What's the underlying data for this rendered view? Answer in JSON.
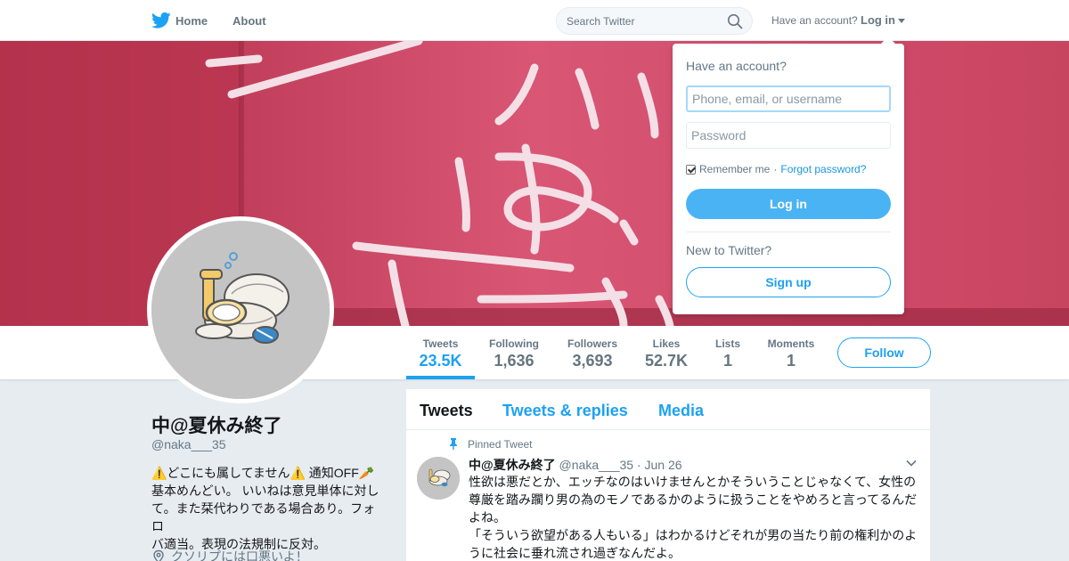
{
  "nav": {
    "home_label": "Home",
    "about_label": "About",
    "search_placeholder": "Search Twitter",
    "have_account": "Have an account?",
    "login_label": "Log in"
  },
  "profile": {
    "name": "中@夏休み終了",
    "handle": "@naka___35",
    "bio_lines": [
      "⚠️どこにも属してません⚠️ 通知OFF🥕",
      "基本めんどい。 いいねは意見単体に対し",
      "て。また栞代わりである場合あり。フォロ",
      "バ適当。表現の法規制に反対。"
    ],
    "location": "クソリプには口悪いよ！"
  },
  "stats": [
    {
      "label": "Tweets",
      "value": "23.5K"
    },
    {
      "label": "Following",
      "value": "1,636"
    },
    {
      "label": "Followers",
      "value": "3,693"
    },
    {
      "label": "Likes",
      "value": "52.7K"
    },
    {
      "label": "Lists",
      "value": "1"
    },
    {
      "label": "Moments",
      "value": "1"
    }
  ],
  "follow_label": "Follow",
  "timeline": {
    "tabs": [
      "Tweets",
      "Tweets & replies",
      "Media"
    ],
    "pinned_label": "Pinned Tweet",
    "tweet": {
      "name": "中@夏休み終了",
      "meta": "@naka___35 · Jun 26",
      "text_lines": [
        "性欲は悪だとか、エッチなのはいけませんとかそういうことじゃなくて、女性の",
        "尊厳を踏み躙り男の為のモノであるかのように扱うことをやめろと言ってるんだ",
        "よね。",
        "「そういう欲望がある人もいる」はわかるけどそれが男の当たり前の権利かのよ",
        "うに社会に垂れ流され過ぎなんだよ。"
      ]
    }
  },
  "login_dropdown": {
    "title": "Have an account?",
    "username_placeholder": "Phone, email, or username",
    "password_placeholder": "Password",
    "remember_label": "Remember me",
    "separator": "·",
    "forgot_label": "Forgot password?",
    "login_button": "Log in",
    "new_label": "New to Twitter?",
    "signup_button": "Sign up"
  },
  "colors": {
    "accent": "#1da1f2",
    "banner": "#c3445f",
    "login_button": "#4ab3f4"
  }
}
